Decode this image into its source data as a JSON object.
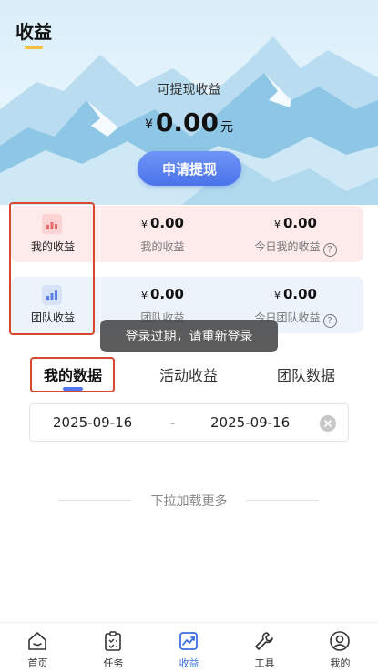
{
  "page": {
    "title": "收益"
  },
  "withdraw": {
    "label": "可提现收益",
    "currency": "¥",
    "amount": "0.00",
    "unit": "元",
    "button": "申请提现"
  },
  "my_card": {
    "label": "我的收益",
    "value1": {
      "currency": "¥",
      "amount": "0.00",
      "label": "我的收益"
    },
    "value2": {
      "currency": "¥",
      "amount": "0.00",
      "label": "今日我的收益"
    }
  },
  "team_card": {
    "label": "团队收益",
    "value1": {
      "currency": "¥",
      "amount": "0.00",
      "label": "团队收益"
    },
    "value2": {
      "currency": "¥",
      "amount": "0.00",
      "label": "今日团队收益"
    }
  },
  "toast": "登录过期，请重新登录",
  "tabs": [
    "我的数据",
    "活动收益",
    "团队数据"
  ],
  "active_tab": 0,
  "date_range": {
    "start": "2025-09-16",
    "separator": "-",
    "end": "2025-09-16"
  },
  "load_more": "下拉加载更多",
  "bottom_nav": [
    {
      "label": "首页",
      "icon": "home-icon"
    },
    {
      "label": "任务",
      "icon": "clipboard-icon"
    },
    {
      "label": "收益",
      "icon": "chart-icon"
    },
    {
      "label": "工具",
      "icon": "wrench-icon"
    },
    {
      "label": "我的",
      "icon": "user-icon"
    }
  ],
  "active_nav": 2,
  "colors": {
    "accent": "#4a73ea",
    "annotation": "#d9472f",
    "tab_indicator": "#5077ee"
  }
}
